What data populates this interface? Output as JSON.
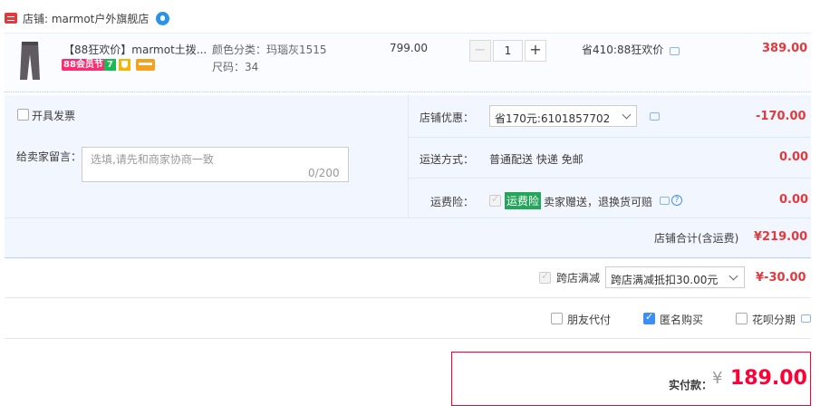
{
  "shop": {
    "name": "店铺: marmot户外旗舰店"
  },
  "item": {
    "title": "【88狂欢价】marmot土拨...",
    "badge_88": "88会员节",
    "badge_7": "7",
    "color": "颜色分类：玛瑙灰1515",
    "size": "尺码：34",
    "price": "799.00",
    "quantity": "1",
    "promo": "省410:88狂欢价",
    "subtotal": "389.00"
  },
  "options": {
    "invoice_label": "开具发票",
    "message_label": "给卖家留言：",
    "message_placeholder": "选填,请先和商家协商一致",
    "message_count": "0/200",
    "discount_label": "店铺优惠：",
    "discount_selected": "省170元:6101857702",
    "discount_amount": "-170.00",
    "shipping_label": "运送方式：",
    "shipping_value": "普通配送 快递 免邮",
    "shipping_amount": "0.00",
    "insurance_label": "运费险：",
    "insurance_tag": "运费险",
    "insurance_text": "卖家赠送，退换货可赔",
    "insurance_amount": "0.00",
    "total_label": "店铺合计(含运费)",
    "total_amount": "¥219.00"
  },
  "cross_store": {
    "label": "跨店满减",
    "selected": "跨店满减抵扣30.00元",
    "amount": "¥-30.00"
  },
  "extras": {
    "friend_pay": "朋友代付",
    "anonymous": "匿名购买",
    "huabei": "花呗分期"
  },
  "payment": {
    "label": "实付款：",
    "currency": "¥",
    "amount": "189.00"
  },
  "colors": {
    "accent_red": "#e4393c",
    "pay_red": "#ff0036",
    "blue_border": "#b2d1ff",
    "panel_bg": "#f2f7ff"
  }
}
